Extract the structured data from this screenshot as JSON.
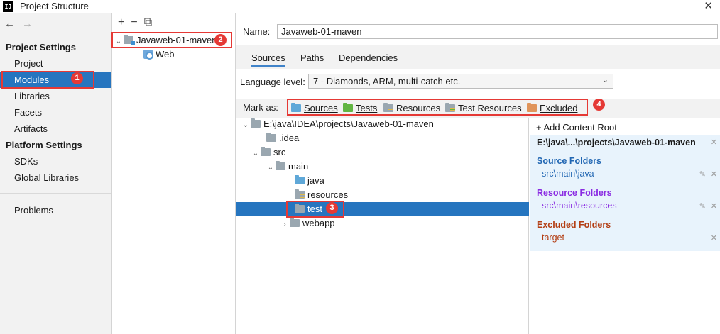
{
  "window": {
    "title": "Project Structure",
    "app_icon": "IJ",
    "close_icon": "✕"
  },
  "nav": {
    "back": "←",
    "forward": "→"
  },
  "sidebar": {
    "project_settings_heading": "Project Settings",
    "project_settings": [
      {
        "label": "Project"
      },
      {
        "label": "Modules",
        "selected": true
      },
      {
        "label": "Libraries"
      },
      {
        "label": "Facets"
      },
      {
        "label": "Artifacts"
      }
    ],
    "platform_settings_heading": "Platform Settings",
    "platform_settings": [
      {
        "label": "SDKs"
      },
      {
        "label": "Global Libraries"
      }
    ],
    "problems": "Problems"
  },
  "module_tree": {
    "toolbar": {
      "add": "+",
      "remove": "−",
      "copy": "⧉"
    },
    "module": "Javaweb-01-maven",
    "facet": "Web"
  },
  "detail": {
    "name_label": "Name:",
    "name_value": "Javaweb-01-maven",
    "tabs": [
      "Sources",
      "Paths",
      "Dependencies"
    ],
    "active_tab": "Sources",
    "language_level_label": "Language level:",
    "language_level_value": "7 - Diamonds, ARM, multi-catch etc.",
    "mark_as_label": "Mark as:",
    "mark_as": [
      "Sources",
      "Tests",
      "Resources",
      "Test Resources",
      "Excluded"
    ]
  },
  "file_tree": {
    "root": "E:\\java\\IDEA\\projects\\Javaweb-01-maven",
    "idea": ".idea",
    "src": "src",
    "main": "main",
    "java": "java",
    "resources": "resources",
    "test": "test",
    "webapp": "webapp"
  },
  "content_root": {
    "add_label": "+ Add Content Root",
    "path": "E:\\java\\...\\projects\\Javaweb-01-maven",
    "source_folders_heading": "Source Folders",
    "source_folder": "src\\main\\java",
    "resource_folders_heading": "Resource Folders",
    "resource_folder": "src\\main\\resources",
    "excluded_folders_heading": "Excluded Folders",
    "excluded_folder": "target",
    "colors": {
      "source": "#2267b3",
      "resource": "#8a2be2",
      "excluded": "#b33e14"
    }
  },
  "annotations": [
    "1",
    "2",
    "3",
    "4"
  ],
  "colors": {
    "selection": "#2675bf",
    "annotation": "#e53935"
  }
}
